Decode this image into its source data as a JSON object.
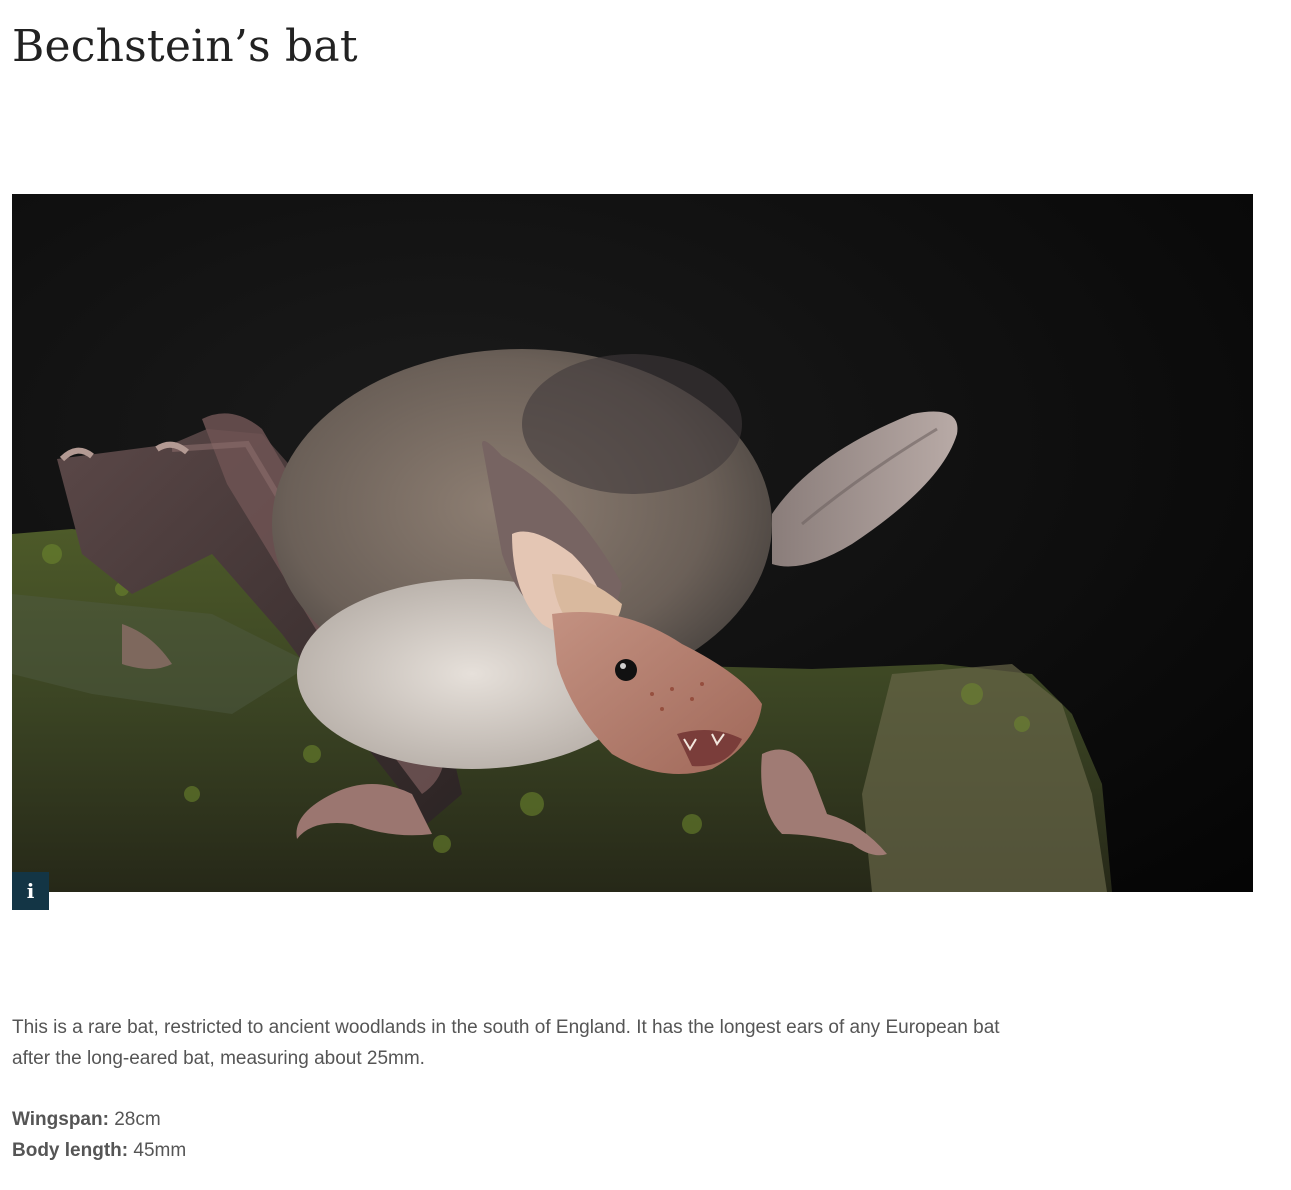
{
  "page": {
    "title": "Bechstein’s bat"
  },
  "hero": {
    "info_icon": "i"
  },
  "content": {
    "description": "This is a rare bat, restricted to ancient woodlands in the south of England. It has the longest ears of any European bat after the long-eared bat, measuring about 25mm.",
    "facts": [
      {
        "label": "Wingspan:",
        "value": "28cm"
      },
      {
        "label": "Body length:",
        "value": "45mm"
      }
    ]
  },
  "colors": {
    "info_button_bg": "#133545",
    "text": "#555555",
    "title": "#222222"
  }
}
